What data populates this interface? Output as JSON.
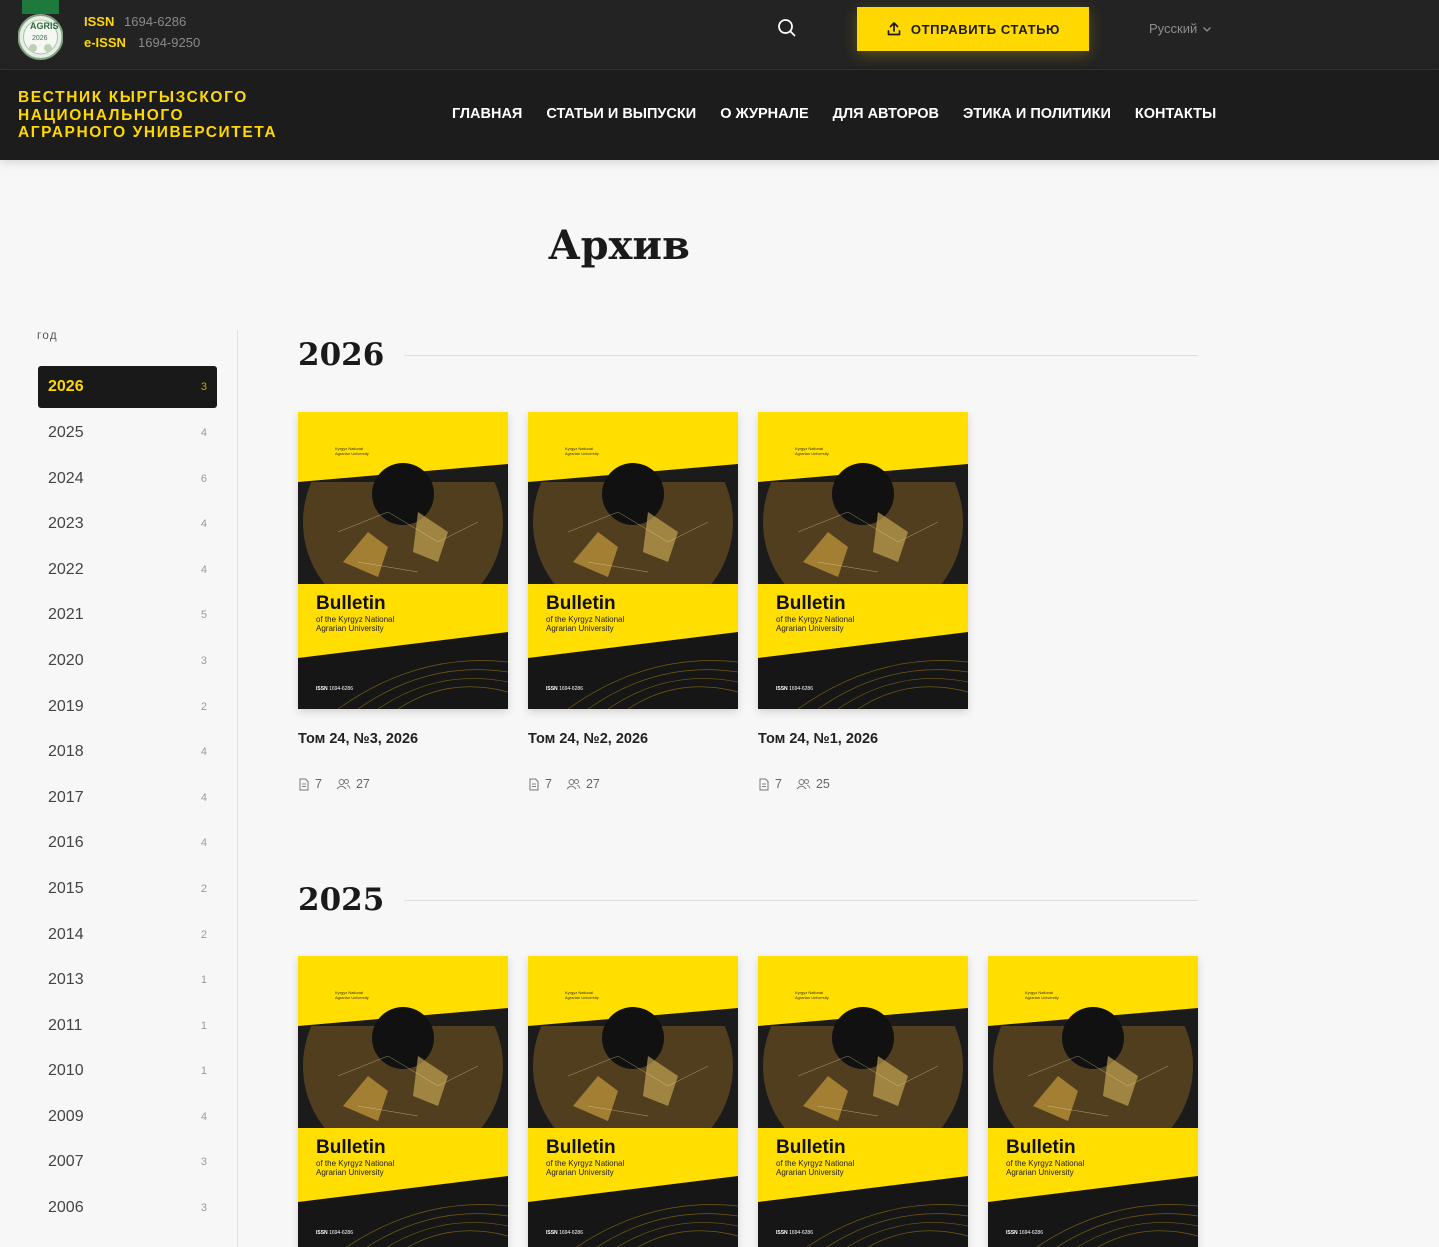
{
  "header": {
    "agris_logo_text": "AGRIS",
    "agris_logo_year": "2026",
    "issn_label": "ISSN",
    "issn_value": "1694-6286",
    "eissn_label": "e-ISSN",
    "eissn_value": "1694-9250",
    "search_icon": "search-icon",
    "submit_label": "ОТПРАВИТЬ СТАТЬЮ",
    "language": "Русский"
  },
  "brand": {
    "line1": "ВЕСТНИК КЫРГЫЗСКОГО",
    "line2": "НАЦИОНАЛЬНОГО",
    "line3": "АГРАРНОГО УНИВЕРСИТЕТА"
  },
  "nav": [
    "ГЛАВНАЯ",
    "СТАТЬИ И ВЫПУСКИ",
    "О ЖУРНАЛЕ",
    "ДЛЯ АВТОРОВ",
    "ЭТИКА И ПОЛИТИКИ",
    "КОНТАКТЫ"
  ],
  "page_title": "Архив",
  "sidebar": {
    "label": "год",
    "years": [
      {
        "year": "2026",
        "count": "3",
        "active": true
      },
      {
        "year": "2025",
        "count": "4"
      },
      {
        "year": "2024",
        "count": "6"
      },
      {
        "year": "2023",
        "count": "4"
      },
      {
        "year": "2022",
        "count": "4"
      },
      {
        "year": "2021",
        "count": "5"
      },
      {
        "year": "2020",
        "count": "3"
      },
      {
        "year": "2019",
        "count": "2"
      },
      {
        "year": "2018",
        "count": "4"
      },
      {
        "year": "2017",
        "count": "4"
      },
      {
        "year": "2016",
        "count": "4"
      },
      {
        "year": "2015",
        "count": "2"
      },
      {
        "year": "2014",
        "count": "2"
      },
      {
        "year": "2013",
        "count": "1"
      },
      {
        "year": "2011",
        "count": "1"
      },
      {
        "year": "2010",
        "count": "1"
      },
      {
        "year": "2009",
        "count": "4"
      },
      {
        "year": "2007",
        "count": "3"
      },
      {
        "year": "2006",
        "count": "3"
      }
    ]
  },
  "cover": {
    "title": "Bulletin",
    "subtitle1": "of the Kyrgyz National",
    "subtitle2": "Agrarian University",
    "logo_line1": "Kyrgyz National",
    "logo_line2": "Agrarian University",
    "issn_label": "ISSN",
    "issn_value": "1694-6286"
  },
  "sections": [
    {
      "year": "2026",
      "issues": [
        {
          "title": "Том 24, №3, 2026",
          "articles": "7",
          "authors": "27"
        },
        {
          "title": "Том 24, №2, 2026",
          "articles": "7",
          "authors": "27"
        },
        {
          "title": "Том 24, №1, 2026",
          "articles": "7",
          "authors": "25"
        }
      ]
    },
    {
      "year": "2025",
      "issues": [
        {
          "title": "",
          "articles": "",
          "authors": ""
        },
        {
          "title": "",
          "articles": "",
          "authors": ""
        },
        {
          "title": "",
          "articles": "",
          "authors": ""
        },
        {
          "title": "",
          "articles": "",
          "authors": ""
        }
      ]
    }
  ],
  "colors": {
    "accent": "#ffd800",
    "header_bg": "#232323",
    "nav_bg": "#1c1c1c",
    "page_bg": "#f7f7f7"
  }
}
